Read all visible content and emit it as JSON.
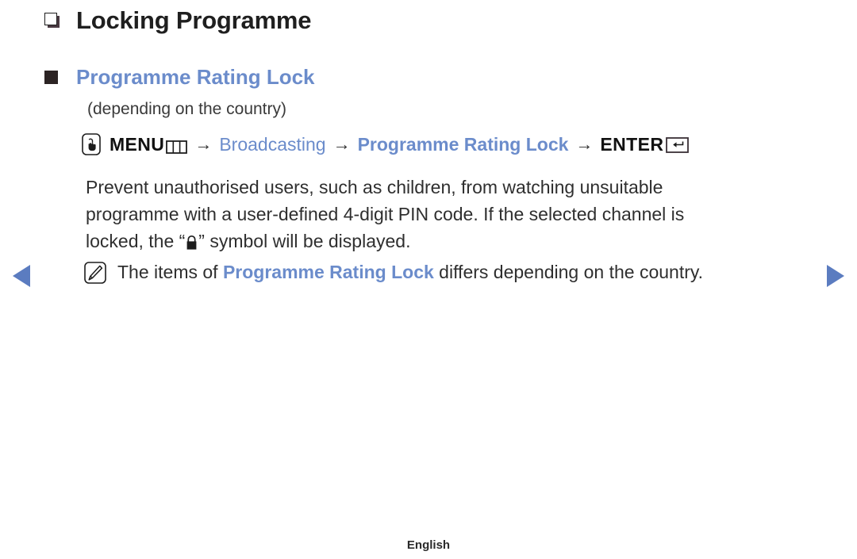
{
  "page": {
    "title": "Locking Programme",
    "section": {
      "heading": "Programme Rating Lock",
      "subnote": "(depending on the country)"
    },
    "menu_path": {
      "press_icon": "press-hand-icon",
      "menu_label": "MENU",
      "menu_cells_icon": "menu-cells-icon",
      "separator": "→",
      "step_broadcasting": "Broadcasting",
      "step_programme_rating_lock": "Programme Rating Lock",
      "enter_label": "ENTER",
      "enter_icon": "enter-key-icon"
    },
    "body": {
      "part1": "Prevent unauthorised users, such as children, from watching unsuitable programme with a user-defined 4-digit PIN code. If the selected channel is locked, the “",
      "lock_icon": "padlock-icon",
      "part2": "” symbol will be displayed."
    },
    "note": {
      "icon": "note-pen-icon",
      "prefix": "The items of ",
      "highlight": "Programme Rating Lock",
      "suffix": " differs depending on the country."
    },
    "navigation": {
      "prev": "previous-page-arrow",
      "next": "next-page-arrow"
    },
    "footer": {
      "language": "English"
    },
    "colors": {
      "accent_blue": "#6b8ccb",
      "arrow_blue": "#5b7cc0",
      "text_dark": "#2f2f2f",
      "background": "#ffffff"
    }
  }
}
